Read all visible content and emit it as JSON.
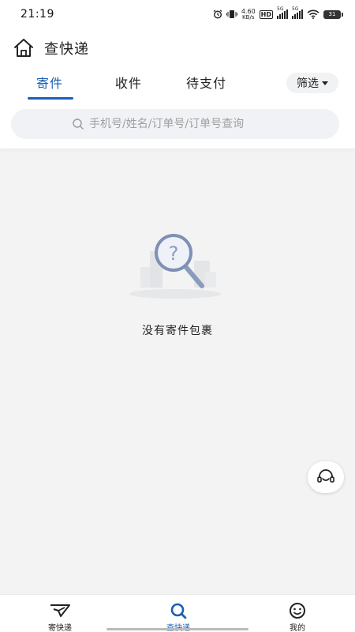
{
  "status_bar": {
    "time": "21:19",
    "net_speed_value": "4.60",
    "net_speed_unit": "KB/s",
    "hd_label": "HD",
    "signal1_label": "5G",
    "signal2_label": "5G",
    "battery": "31"
  },
  "header": {
    "title": "查快递",
    "home_icon": "home-icon"
  },
  "tabs": [
    {
      "label": "寄件",
      "active": true
    },
    {
      "label": "收件",
      "active": false
    },
    {
      "label": "待支付",
      "active": false
    }
  ],
  "filter": {
    "label": "筛选"
  },
  "search": {
    "placeholder": "手机号/姓名/订单号/订单号查询"
  },
  "empty_state": {
    "text": "没有寄件包裹"
  },
  "bottom_nav": [
    {
      "label": "寄快递",
      "icon": "send-package-icon",
      "active": false
    },
    {
      "label": "查快递",
      "icon": "search-icon",
      "active": true
    },
    {
      "label": "我的",
      "icon": "smile-face-icon",
      "active": false
    }
  ],
  "colors": {
    "accent": "#1a5fb4",
    "background": "#f3f3f4"
  }
}
